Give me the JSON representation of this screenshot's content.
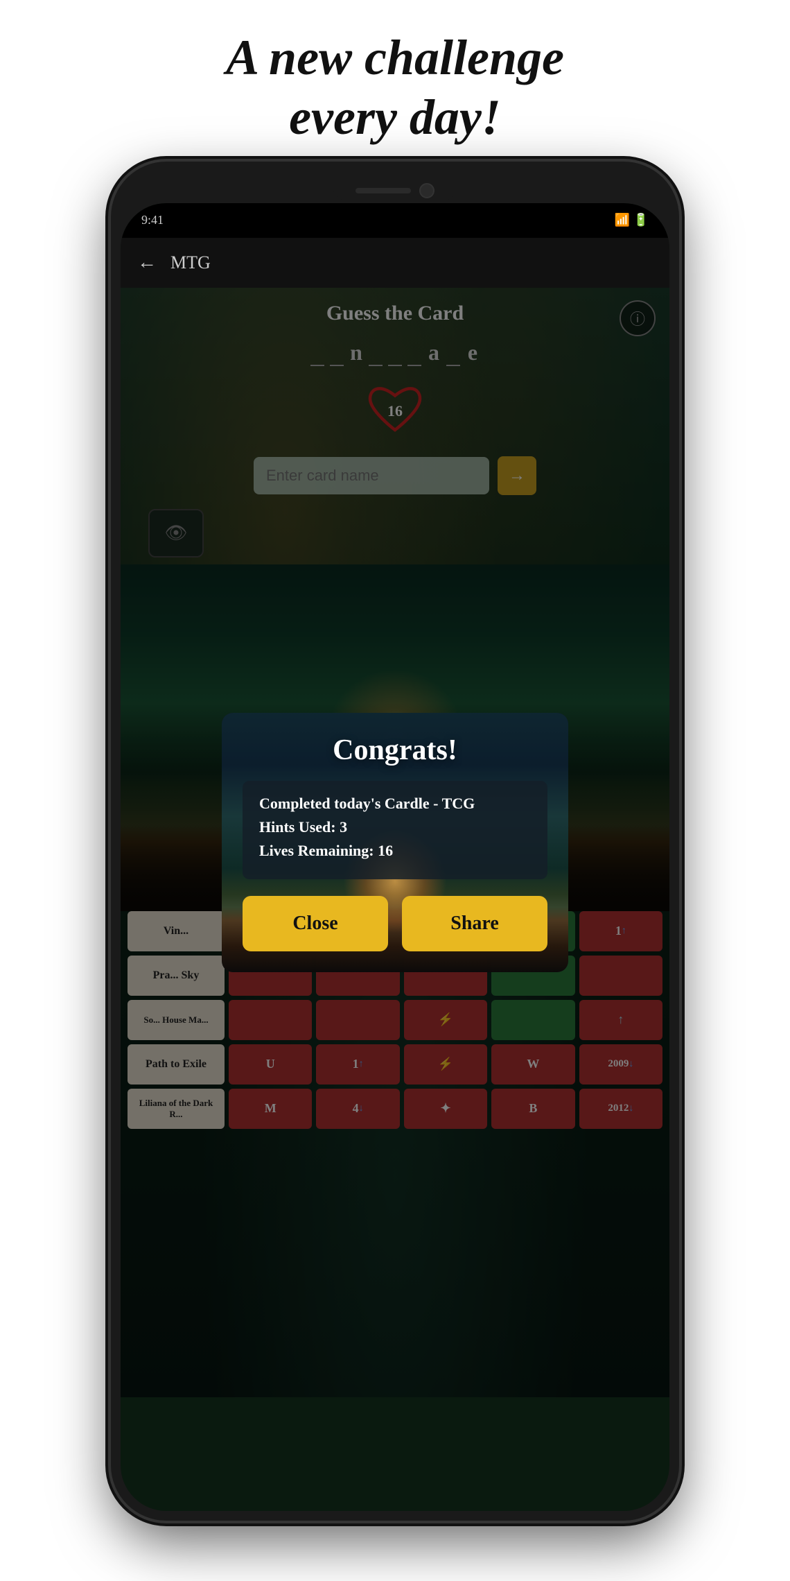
{
  "tagline": {
    "line1": "A new challenge",
    "line2": "every day!"
  },
  "app": {
    "title": "MTG",
    "back_label": "←"
  },
  "game": {
    "title": "Guess the Card",
    "info_icon": "ⓘ",
    "letters": [
      "_",
      "_",
      "n",
      "_",
      "_",
      "_",
      "a",
      "_",
      "e"
    ],
    "hearts": 16,
    "input_placeholder": "Enter card name",
    "submit_icon": "→",
    "eye_icon": "👁"
  },
  "modal": {
    "title": "Congrats!",
    "stat1": "Completed today's Cardle - TCG",
    "stat2": "Hints Used: 3",
    "stat3": "Lives Remaining: 16",
    "close_label": "Close",
    "share_label": "Share"
  },
  "guess_rows": [
    {
      "name": "Vin...",
      "cells": [
        {
          "value": "",
          "color": "red"
        },
        {
          "value": "",
          "color": "red"
        },
        {
          "value": "",
          "color": "red"
        },
        {
          "value": "",
          "color": "green"
        },
        {
          "value": "1 ↑",
          "color": "red"
        }
      ]
    },
    {
      "name": "Pra... Sky",
      "cells": [
        {
          "value": "",
          "color": "red"
        },
        {
          "value": "",
          "color": "red"
        },
        {
          "value": "",
          "color": "red"
        },
        {
          "value": "",
          "color": "green"
        },
        {
          "value": "",
          "color": "red"
        }
      ]
    },
    {
      "name": "So... House Ma...",
      "cells": [
        {
          "value": "",
          "color": "red"
        },
        {
          "value": "",
          "color": "red"
        },
        {
          "value": "⚡",
          "color": "red"
        },
        {
          "value": "",
          "color": "green"
        },
        {
          "value": "",
          "color": "red"
        }
      ]
    },
    {
      "name": "Path to Exile",
      "cells": [
        {
          "value": "U",
          "color": "red"
        },
        {
          "value": "1 ↑",
          "color": "red"
        },
        {
          "value": "⚡",
          "color": "red"
        },
        {
          "value": "W",
          "color": "red"
        },
        {
          "value": "2009 ↓",
          "color": "red"
        }
      ]
    },
    {
      "name": "Liliana of the Dark R...",
      "cells": [
        {
          "value": "M",
          "color": "red"
        },
        {
          "value": "4 ↓",
          "color": "red"
        },
        {
          "value": "✦",
          "color": "red"
        },
        {
          "value": "B",
          "color": "red"
        },
        {
          "value": "2012 ↓",
          "color": "red"
        }
      ]
    }
  ]
}
